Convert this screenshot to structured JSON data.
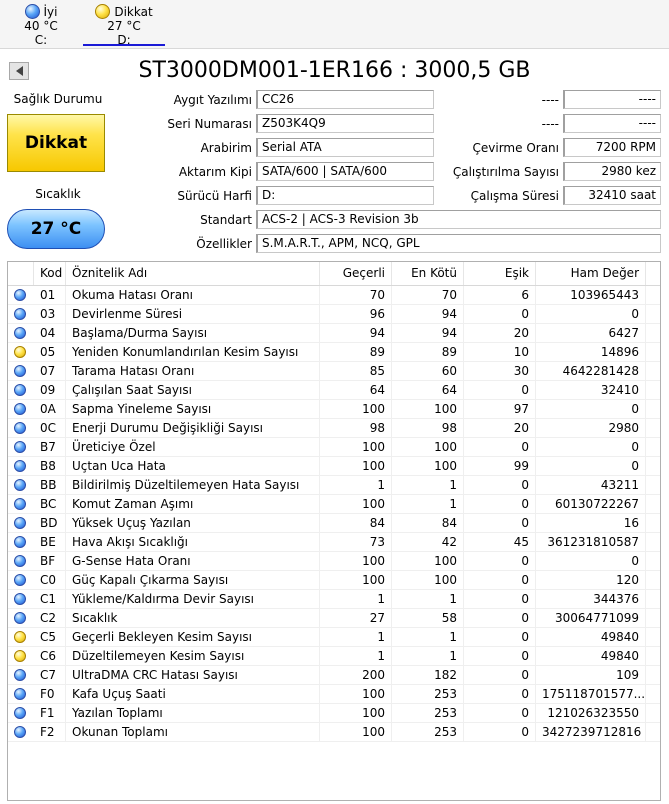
{
  "disk_tabs": [
    {
      "status": "good",
      "status_label": "İyi",
      "temp": "40 °C",
      "drive": "C:"
    },
    {
      "status": "caution",
      "status_label": "Dikkat",
      "temp": "27 °C",
      "drive": "D:"
    }
  ],
  "drive_title": "ST3000DM001-1ER166 : 3000,5 GB",
  "health": {
    "label": "Sağlık Durumu",
    "value": "Dikkat",
    "color": "#ffe34a"
  },
  "temperature": {
    "label": "Sıcaklık",
    "value": "27 °C",
    "color": "#7cc3ff"
  },
  "info": {
    "firmware": {
      "label": "Aygıt Yazılımı",
      "value": "CC26"
    },
    "serial": {
      "label": "Seri Numarası",
      "value": "Z503K4Q9"
    },
    "interface": {
      "label": "Arabirim",
      "value": "Serial ATA"
    },
    "transfer": {
      "label": "Aktarım Kipi",
      "value": "SATA/600 | SATA/600"
    },
    "drive_letter": {
      "label": "Sürücü Harfi",
      "value": "D:"
    },
    "standard": {
      "label": "Standart",
      "value": "ACS-2 | ACS-3 Revision 3b"
    },
    "features": {
      "label": "Özellikler",
      "value": "S.M.A.R.T., APM, NCQ, GPL"
    },
    "right1": {
      "label": "----",
      "value": "----"
    },
    "right2": {
      "label": "----",
      "value": "----"
    },
    "rotation": {
      "label": "Çevirme Oranı",
      "value": "7200 RPM"
    },
    "power_on_count": {
      "label": "Çalıştırılma Sayısı",
      "value": "2980 kez"
    },
    "power_on_hours": {
      "label": "Çalışma Süresi",
      "value": "32410 saat"
    }
  },
  "smart": {
    "columns": [
      "Kod",
      "Öznitelik Adı",
      "Geçerli",
      "En Kötü",
      "Eşik",
      "Ham Değer"
    ],
    "rows": [
      {
        "status": "good",
        "id": "01",
        "name": "Okuma Hatası Oranı",
        "current": "70",
        "worst": "70",
        "threshold": "6",
        "raw": "103965443"
      },
      {
        "status": "good",
        "id": "03",
        "name": "Devirlenme Süresi",
        "current": "96",
        "worst": "94",
        "threshold": "0",
        "raw": "0"
      },
      {
        "status": "good",
        "id": "04",
        "name": "Başlama/Durma Sayısı",
        "current": "94",
        "worst": "94",
        "threshold": "20",
        "raw": "6427"
      },
      {
        "status": "caution",
        "id": "05",
        "name": "Yeniden Konumlandırılan Kesim Sayısı",
        "current": "89",
        "worst": "89",
        "threshold": "10",
        "raw": "14896"
      },
      {
        "status": "good",
        "id": "07",
        "name": "Tarama Hatası Oranı",
        "current": "85",
        "worst": "60",
        "threshold": "30",
        "raw": "4642281428"
      },
      {
        "status": "good",
        "id": "09",
        "name": "Çalışılan Saat Sayısı",
        "current": "64",
        "worst": "64",
        "threshold": "0",
        "raw": "32410"
      },
      {
        "status": "good",
        "id": "0A",
        "name": "Sapma Yineleme Sayısı",
        "current": "100",
        "worst": "100",
        "threshold": "97",
        "raw": "0"
      },
      {
        "status": "good",
        "id": "0C",
        "name": "Enerji Durumu Değişikliği Sayısı",
        "current": "98",
        "worst": "98",
        "threshold": "20",
        "raw": "2980"
      },
      {
        "status": "good",
        "id": "B7",
        "name": "Üreticiye Özel",
        "current": "100",
        "worst": "100",
        "threshold": "0",
        "raw": "0"
      },
      {
        "status": "good",
        "id": "B8",
        "name": "Uçtan Uca Hata",
        "current": "100",
        "worst": "100",
        "threshold": "99",
        "raw": "0"
      },
      {
        "status": "good",
        "id": "BB",
        "name": "Bildirilmiş Düzeltilemeyen Hata Sayısı",
        "current": "1",
        "worst": "1",
        "threshold": "0",
        "raw": "43211"
      },
      {
        "status": "good",
        "id": "BC",
        "name": "Komut Zaman Aşımı",
        "current": "100",
        "worst": "1",
        "threshold": "0",
        "raw": "60130722267"
      },
      {
        "status": "good",
        "id": "BD",
        "name": "Yüksek Uçuş Yazılan",
        "current": "84",
        "worst": "84",
        "threshold": "0",
        "raw": "16"
      },
      {
        "status": "good",
        "id": "BE",
        "name": "Hava Akışı Sıcaklığı",
        "current": "73",
        "worst": "42",
        "threshold": "45",
        "raw": "361231810587"
      },
      {
        "status": "good",
        "id": "BF",
        "name": "G-Sense Hata Oranı",
        "current": "100",
        "worst": "100",
        "threshold": "0",
        "raw": "0"
      },
      {
        "status": "good",
        "id": "C0",
        "name": "Güç Kapalı Çıkarma Sayısı",
        "current": "100",
        "worst": "100",
        "threshold": "0",
        "raw": "120"
      },
      {
        "status": "good",
        "id": "C1",
        "name": "Yükleme/Kaldırma Devir Sayısı",
        "current": "1",
        "worst": "1",
        "threshold": "0",
        "raw": "344376"
      },
      {
        "status": "good",
        "id": "C2",
        "name": "Sıcaklık",
        "current": "27",
        "worst": "58",
        "threshold": "0",
        "raw": "30064771099"
      },
      {
        "status": "caution",
        "id": "C5",
        "name": "Geçerli Bekleyen Kesim Sayısı",
        "current": "1",
        "worst": "1",
        "threshold": "0",
        "raw": "49840"
      },
      {
        "status": "caution",
        "id": "C6",
        "name": "Düzeltilemeyen Kesim Sayısı",
        "current": "1",
        "worst": "1",
        "threshold": "0",
        "raw": "49840"
      },
      {
        "status": "good",
        "id": "C7",
        "name": "UltraDMA CRC Hatası Sayısı",
        "current": "200",
        "worst": "182",
        "threshold": "0",
        "raw": "109"
      },
      {
        "status": "good",
        "id": "F0",
        "name": "Kafa Uçuş Saati",
        "current": "100",
        "worst": "253",
        "threshold": "0",
        "raw": "175118701577..."
      },
      {
        "status": "good",
        "id": "F1",
        "name": "Yazılan Toplamı",
        "current": "100",
        "worst": "253",
        "threshold": "0",
        "raw": "121026323550"
      },
      {
        "status": "good",
        "id": "F2",
        "name": "Okunan Toplamı",
        "current": "100",
        "worst": "253",
        "threshold": "0",
        "raw": "3427239712816"
      }
    ]
  }
}
